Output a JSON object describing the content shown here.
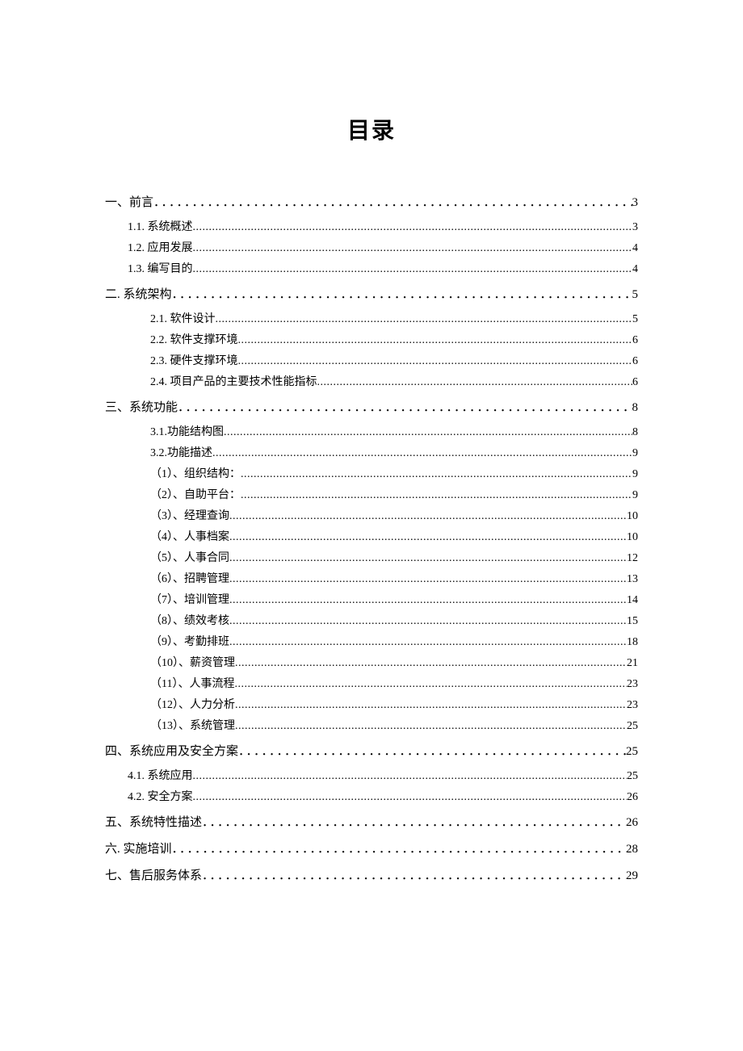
{
  "title": "目录",
  "entries": [
    {
      "level": 1,
      "label": "一、前言",
      "page": "3",
      "dotstyle": "big"
    },
    {
      "level": 2,
      "label": "1.1.  系统概述",
      "page": "3",
      "dotstyle": "small"
    },
    {
      "level": 2,
      "label": "1.2.  应用发展",
      "page": "4",
      "dotstyle": "small"
    },
    {
      "level": 2,
      "label": "1.3.  编写目的",
      "page": "4",
      "dotstyle": "small"
    },
    {
      "level": 1,
      "label": "二.  系统架构",
      "page": "5",
      "dotstyle": "big"
    },
    {
      "level": 3,
      "label": "2.1. 软件设计",
      "page": "5",
      "dotstyle": "small"
    },
    {
      "level": 3,
      "label": "2.2.  软件支撑环境",
      "page": "6",
      "dotstyle": "small"
    },
    {
      "level": 3,
      "label": "2.3.  硬件支撑环境",
      "page": "6",
      "dotstyle": "small"
    },
    {
      "level": 3,
      "label": "2.4.  项目产品的主要技术性能指标",
      "page": "6",
      "dotstyle": "small"
    },
    {
      "level": 1,
      "label": "三、系统功能",
      "page": "8",
      "dotstyle": "big"
    },
    {
      "level": 3,
      "label": "3.1.功能结构图",
      "page": "8",
      "dotstyle": "small"
    },
    {
      "level": 3,
      "label": "3.2.功能描述",
      "page": "9",
      "dotstyle": "small"
    },
    {
      "level": 4,
      "label": "（1）、组织结构：",
      "page": "9",
      "dotstyle": "small"
    },
    {
      "level": 4,
      "label": "（2）、自助平台：",
      "page": "9",
      "dotstyle": "small"
    },
    {
      "level": 4,
      "label": "（3）、经理查询",
      "page": "10",
      "dotstyle": "small"
    },
    {
      "level": 4,
      "label": "（4）、人事档案",
      "page": "10",
      "dotstyle": "small"
    },
    {
      "level": 4,
      "label": "（5）、人事合同",
      "page": "12",
      "dotstyle": "small"
    },
    {
      "level": 4,
      "label": "（6）、招聘管理",
      "page": "13",
      "dotstyle": "small"
    },
    {
      "level": 4,
      "label": "（7）、培训管理",
      "page": "14",
      "dotstyle": "small"
    },
    {
      "level": 4,
      "label": "（8）、绩效考核",
      "page": "15",
      "dotstyle": "small"
    },
    {
      "level": 4,
      "label": "（9）、考勤排班",
      "page": "18",
      "dotstyle": "small"
    },
    {
      "level": 4,
      "label": "（10）、薪资管理",
      "page": "21",
      "dotstyle": "small"
    },
    {
      "level": 4,
      "label": "（11）、人事流程",
      "page": "23",
      "dotstyle": "small"
    },
    {
      "level": 4,
      "label": "（12）、人力分析",
      "page": "23",
      "dotstyle": "small"
    },
    {
      "level": 4,
      "label": "（13）、系统管理",
      "page": "25",
      "dotstyle": "small"
    },
    {
      "level": 1,
      "label": "四、系统应用及安全方案",
      "page": "25",
      "dotstyle": "big"
    },
    {
      "level": 2,
      "label": "4.1.  系统应用",
      "page": "25",
      "dotstyle": "small"
    },
    {
      "level": 2,
      "label": "4.2.  安全方案",
      "page": "26",
      "dotstyle": "small"
    },
    {
      "level": 1,
      "label": "五、系统特性描述",
      "page": "26",
      "dotstyle": "big"
    },
    {
      "level": 1,
      "label": "六.  实施培训",
      "page": "28",
      "dotstyle": "big"
    },
    {
      "level": 1,
      "label": "七、售后服务体系",
      "page": "29",
      "dotstyle": "big"
    }
  ]
}
